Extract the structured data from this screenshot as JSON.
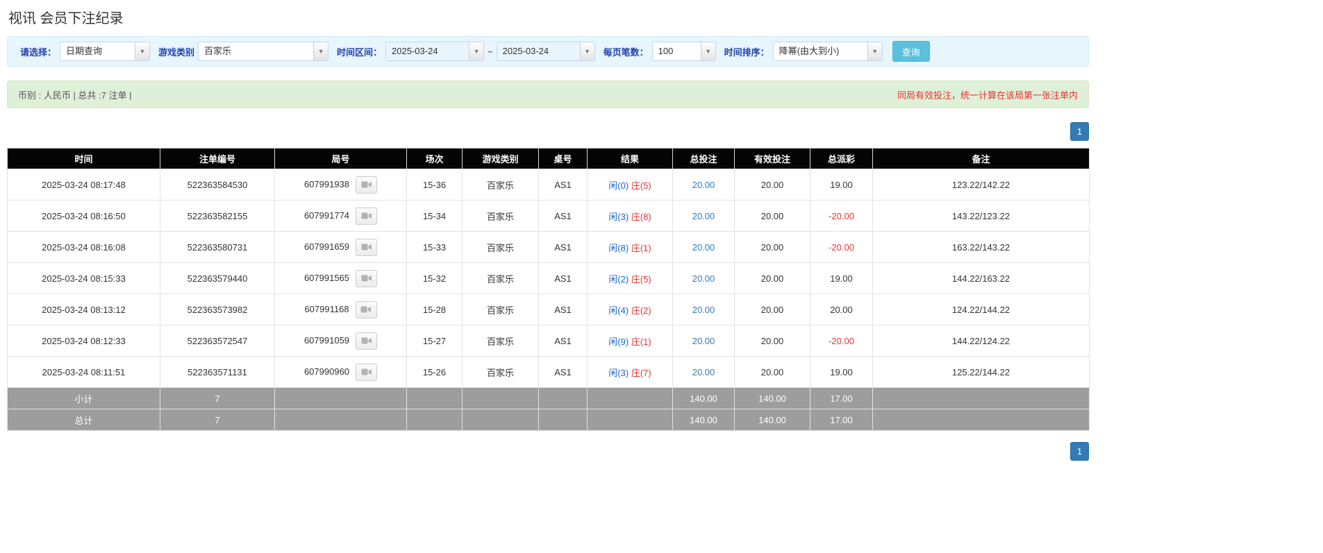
{
  "page_title": "视讯 会员下注纪录",
  "filters": {
    "select_label": "请选择：",
    "select_value": "日期查询",
    "game_type_label": "游戏类别",
    "game_type_value": "百家乐",
    "time_range_label": "时间区间：",
    "date_from": "2025-03-24",
    "tilde": "~",
    "date_to": "2025-03-24",
    "page_size_label": "每页笔数：",
    "page_size_value": "100",
    "sort_label": "时间排序：",
    "sort_value": "降幂(由大到小)",
    "search_button_label": "查询"
  },
  "summary_bar": {
    "left_text": "币别 : 人民币 | 总共 :7 注单 |",
    "right_text": "同局有效投注，统一计算在该局第一张注单内"
  },
  "pagination": {
    "top_page": "1",
    "bottom_page": "1"
  },
  "table": {
    "headers": [
      "时间",
      "注单编号",
      "局号",
      "场次",
      "游戏类别",
      "桌号",
      "结果",
      "总投注",
      "有效投注",
      "总派彩",
      "备注"
    ],
    "rows": [
      {
        "time": "2025-03-24 08:17:48",
        "bet_no": "522363584530",
        "round_no": "607991938",
        "session": "15-36",
        "game_type": "百家乐",
        "table_no": "AS1",
        "result_player": "闲(0)",
        "result_banker": "庄(5)",
        "total_bet": "20.00",
        "valid_bet": "20.00",
        "payout": "19.00",
        "remark": "123.22/142.22"
      },
      {
        "time": "2025-03-24 08:16:50",
        "bet_no": "522363582155",
        "round_no": "607991774",
        "session": "15-34",
        "game_type": "百家乐",
        "table_no": "AS1",
        "result_player": "闲(3)",
        "result_banker": "庄(8)",
        "total_bet": "20.00",
        "valid_bet": "20.00",
        "payout": "-20.00",
        "remark": "143.22/123.22"
      },
      {
        "time": "2025-03-24 08:16:08",
        "bet_no": "522363580731",
        "round_no": "607991659",
        "session": "15-33",
        "game_type": "百家乐",
        "table_no": "AS1",
        "result_player": "闲(8)",
        "result_banker": "庄(1)",
        "total_bet": "20.00",
        "valid_bet": "20.00",
        "payout": "-20.00",
        "remark": "163.22/143.22"
      },
      {
        "time": "2025-03-24 08:15:33",
        "bet_no": "522363579440",
        "round_no": "607991565",
        "session": "15-32",
        "game_type": "百家乐",
        "table_no": "AS1",
        "result_player": "闲(2)",
        "result_banker": "庄(5)",
        "total_bet": "20.00",
        "valid_bet": "20.00",
        "payout": "19.00",
        "remark": "144.22/163.22"
      },
      {
        "time": "2025-03-24 08:13:12",
        "bet_no": "522363573982",
        "round_no": "607991168",
        "session": "15-28",
        "game_type": "百家乐",
        "table_no": "AS1",
        "result_player": "闲(4)",
        "result_banker": "庄(2)",
        "total_bet": "20.00",
        "valid_bet": "20.00",
        "payout": "20.00",
        "remark": "124.22/144.22"
      },
      {
        "time": "2025-03-24 08:12:33",
        "bet_no": "522363572547",
        "round_no": "607991059",
        "session": "15-27",
        "game_type": "百家乐",
        "table_no": "AS1",
        "result_player": "闲(9)",
        "result_banker": "庄(1)",
        "total_bet": "20.00",
        "valid_bet": "20.00",
        "payout": "-20.00",
        "remark": "144.22/124.22"
      },
      {
        "time": "2025-03-24 08:11:51",
        "bet_no": "522363571131",
        "round_no": "607990960",
        "session": "15-26",
        "game_type": "百家乐",
        "table_no": "AS1",
        "result_player": "闲(3)",
        "result_banker": "庄(7)",
        "total_bet": "20.00",
        "valid_bet": "20.00",
        "payout": "19.00",
        "remark": "125.22/144.22"
      }
    ],
    "subtotal_row": {
      "label": "小计",
      "count": "7",
      "total_bet": "140.00",
      "valid_bet": "140.00",
      "payout": "17.00"
    },
    "total_row": {
      "label": "总计",
      "count": "7",
      "total_bet": "140.00",
      "valid_bet": "140.00",
      "payout": "17.00"
    }
  },
  "colors": {
    "accent_blue": "#337ab7",
    "search_button_bg": "#5bc0de",
    "filter_bar_bg": "#e7f5fd",
    "summary_bar_bg": "#dff0d8",
    "header_bg": "#050505",
    "footer_bg": "#9d9d9d",
    "result_player_blue": "#1a66cc",
    "result_banker_red": "#e53333",
    "negative_red": "#e53333"
  }
}
